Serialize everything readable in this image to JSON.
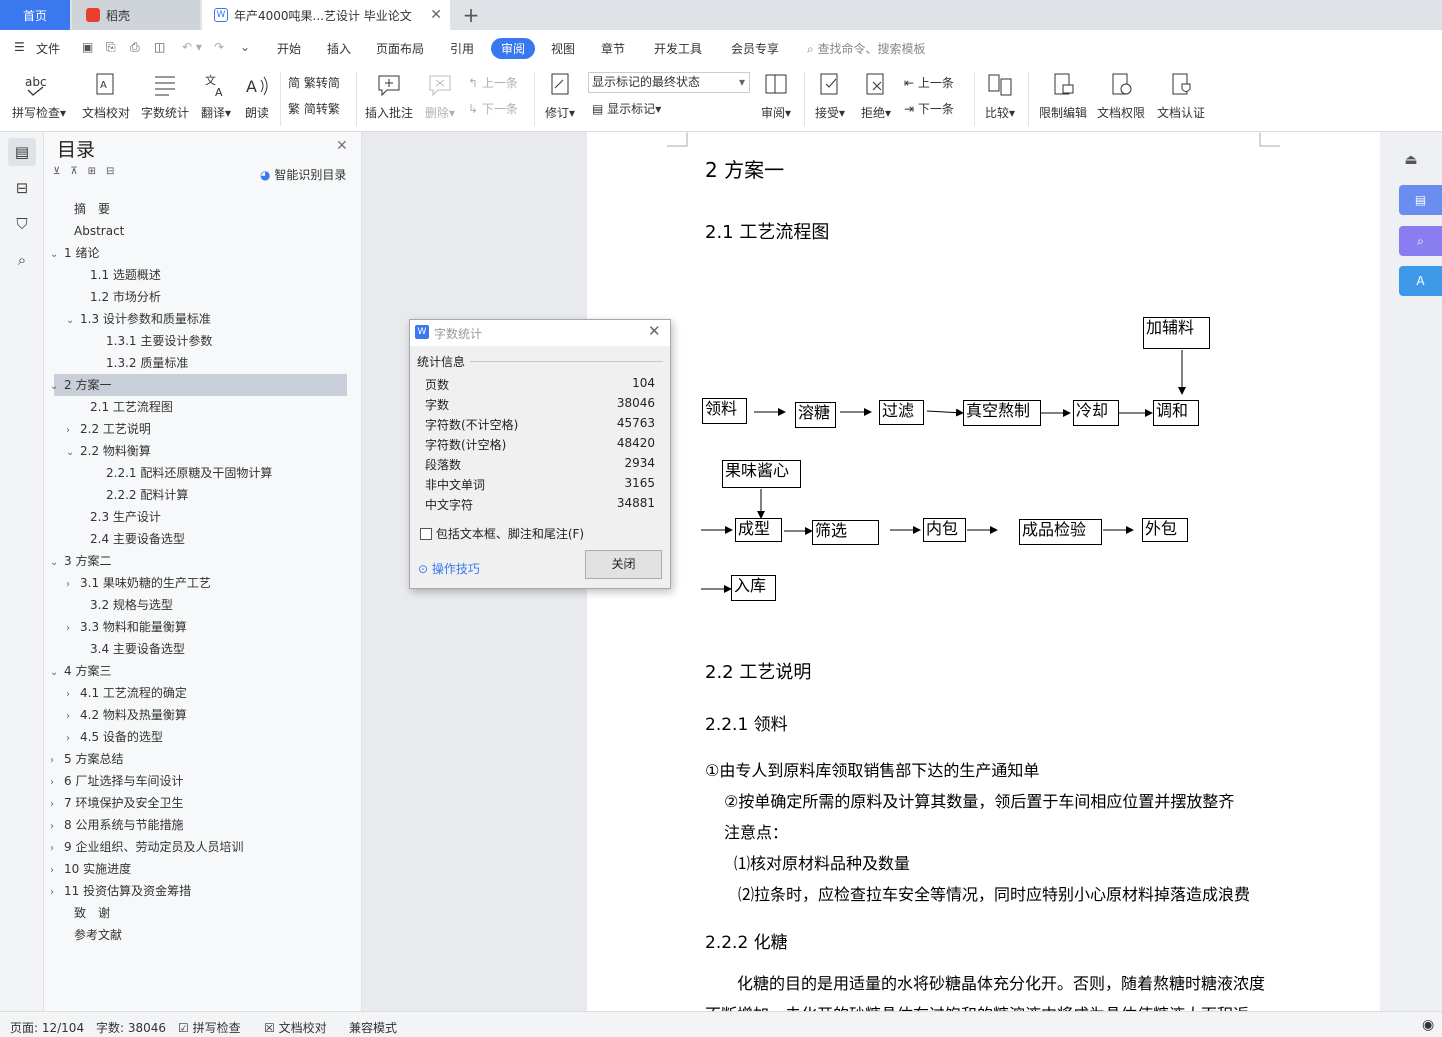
{
  "tabs": {
    "home": "首页",
    "docer": "稻壳",
    "doc": "年产4000吨果...艺设计 毕业论文"
  },
  "menu": {
    "file": "文件",
    "items": [
      "开始",
      "插入",
      "页面布局",
      "引用",
      "审阅",
      "视图",
      "章节",
      "开发工具",
      "会员专享"
    ],
    "search": "查找命令、搜索模板"
  },
  "ribbon": {
    "spell": "拼写检查",
    "proof": "文档校对",
    "wordcount": "字数统计",
    "translate": "翻译",
    "read": "朗读",
    "trad": "繁转简",
    "simp": "简转繁",
    "insert_comment": "插入批注",
    "delete": "删除",
    "prev": "上一条",
    "next": "下一条",
    "revise": "修订",
    "display_state": "显示标记的最终状态",
    "show_markup": "显示标记",
    "review": "审阅",
    "accept": "接受",
    "reject": "拒绝",
    "prev2": "上一条",
    "next2": "下一条",
    "compare": "比较",
    "restrict": "限制编辑",
    "perm": "文档权限",
    "cert": "文档认证"
  },
  "outline": {
    "title": "目录",
    "smart": "智能识别目录",
    "items": [
      {
        "t": "摘　要"
      },
      {
        "t": "Abstract"
      },
      {
        "t": "1 绪论"
      },
      {
        "t": "1.1 选题概述"
      },
      {
        "t": "1.2 市场分析"
      },
      {
        "t": "1.3 设计参数和质量标准"
      },
      {
        "t": "1.3.1 主要设计参数"
      },
      {
        "t": "1.3.2 质量标准"
      },
      {
        "t": "2 方案一"
      },
      {
        "t": "2.1 工艺流程图"
      },
      {
        "t": "2.2 工艺说明"
      },
      {
        "t": "2.2 物料衡算"
      },
      {
        "t": "2.2.1 配料还原糖及干固物计算"
      },
      {
        "t": "2.2.2 配料计算"
      },
      {
        "t": "2.3 生产设计"
      },
      {
        "t": "2.4 主要设备选型"
      },
      {
        "t": "3 方案二"
      },
      {
        "t": "3.1 果味奶糖的生产工艺"
      },
      {
        "t": "3.2 规格与选型"
      },
      {
        "t": "3.3 物料和能量衡算"
      },
      {
        "t": "3.4 主要设备选型"
      },
      {
        "t": "4 方案三"
      },
      {
        "t": "4.1 工艺流程的确定"
      },
      {
        "t": "4.2 物料及热量衡算"
      },
      {
        "t": "4.5 设备的选型"
      },
      {
        "t": "5 方案总结"
      },
      {
        "t": "6 厂址选择与车间设计"
      },
      {
        "t": "7 环境保护及安全卫生"
      },
      {
        "t": "8 公用系统与节能措施"
      },
      {
        "t": "9 企业组织、劳动定员及人员培训"
      },
      {
        "t": "10 实施进度"
      },
      {
        "t": "11 投资估算及资金筹措"
      },
      {
        "t": "致　谢"
      },
      {
        "t": "参考文献"
      }
    ]
  },
  "doc": {
    "h1": "2 方案一",
    "h2a": "2.1 工艺流程图",
    "flow": {
      "b1": "加辅料",
      "b2": "领料",
      "b3": "溶糖",
      "b4": "过滤",
      "b5": "真空熬制",
      "b6": "冷却",
      "b7": "调和",
      "b8": "果味酱心",
      "b9": "成型",
      "b10": "筛选",
      "b11": "内包",
      "b12": "成品检验",
      "b13": "外包",
      "b14": "入库"
    },
    "h2b": "2.2 工艺说明",
    "h3a": "2.2.1 领料",
    "p1": "①由专人到原料库领取销售部下达的生产通知单",
    "p2": "②按单确定所需的原料及计算其数量，领后置于车间相应位置并摆放整齐",
    "p3": "注意点：",
    "p4": "⑴核对原材料品种及数量",
    "p5": "⑵拉条时，应检查拉车安全等情况，同时应特别小心原材料掉落造成浪费",
    "h3b": "2.2.2 化糖",
    "p6": "化糖的目的是用适量的水将砂糖晶体充分化开。否则，随着熬糖时糖液浓度",
    "p7": "不断增加，未化开的砂糖晶体在过饱和的糖溶液中将成为晶体使糖液大面积返"
  },
  "dialog": {
    "title": "字数统计",
    "section": "统计信息",
    "rows": [
      {
        "k": "页数",
        "v": "104"
      },
      {
        "k": "字数",
        "v": "38046"
      },
      {
        "k": "字符数(不计空格)",
        "v": "45763"
      },
      {
        "k": "字符数(计空格)",
        "v": "48420"
      },
      {
        "k": "段落数",
        "v": "2934"
      },
      {
        "k": "非中文单词",
        "v": "3165"
      },
      {
        "k": "中文字符",
        "v": "34881"
      }
    ],
    "checkbox": "包括文本框、脚注和尾注(F)",
    "tips": "操作技巧",
    "close": "关闭"
  },
  "status": {
    "page": "页面: 12/104",
    "words": "字数: 38046",
    "spell": "拼写检查",
    "proof": "文档校对",
    "compat": "兼容模式"
  },
  "colors": {
    "accent": "#3a78ef",
    "outline_sel": "#c8cfd8"
  }
}
